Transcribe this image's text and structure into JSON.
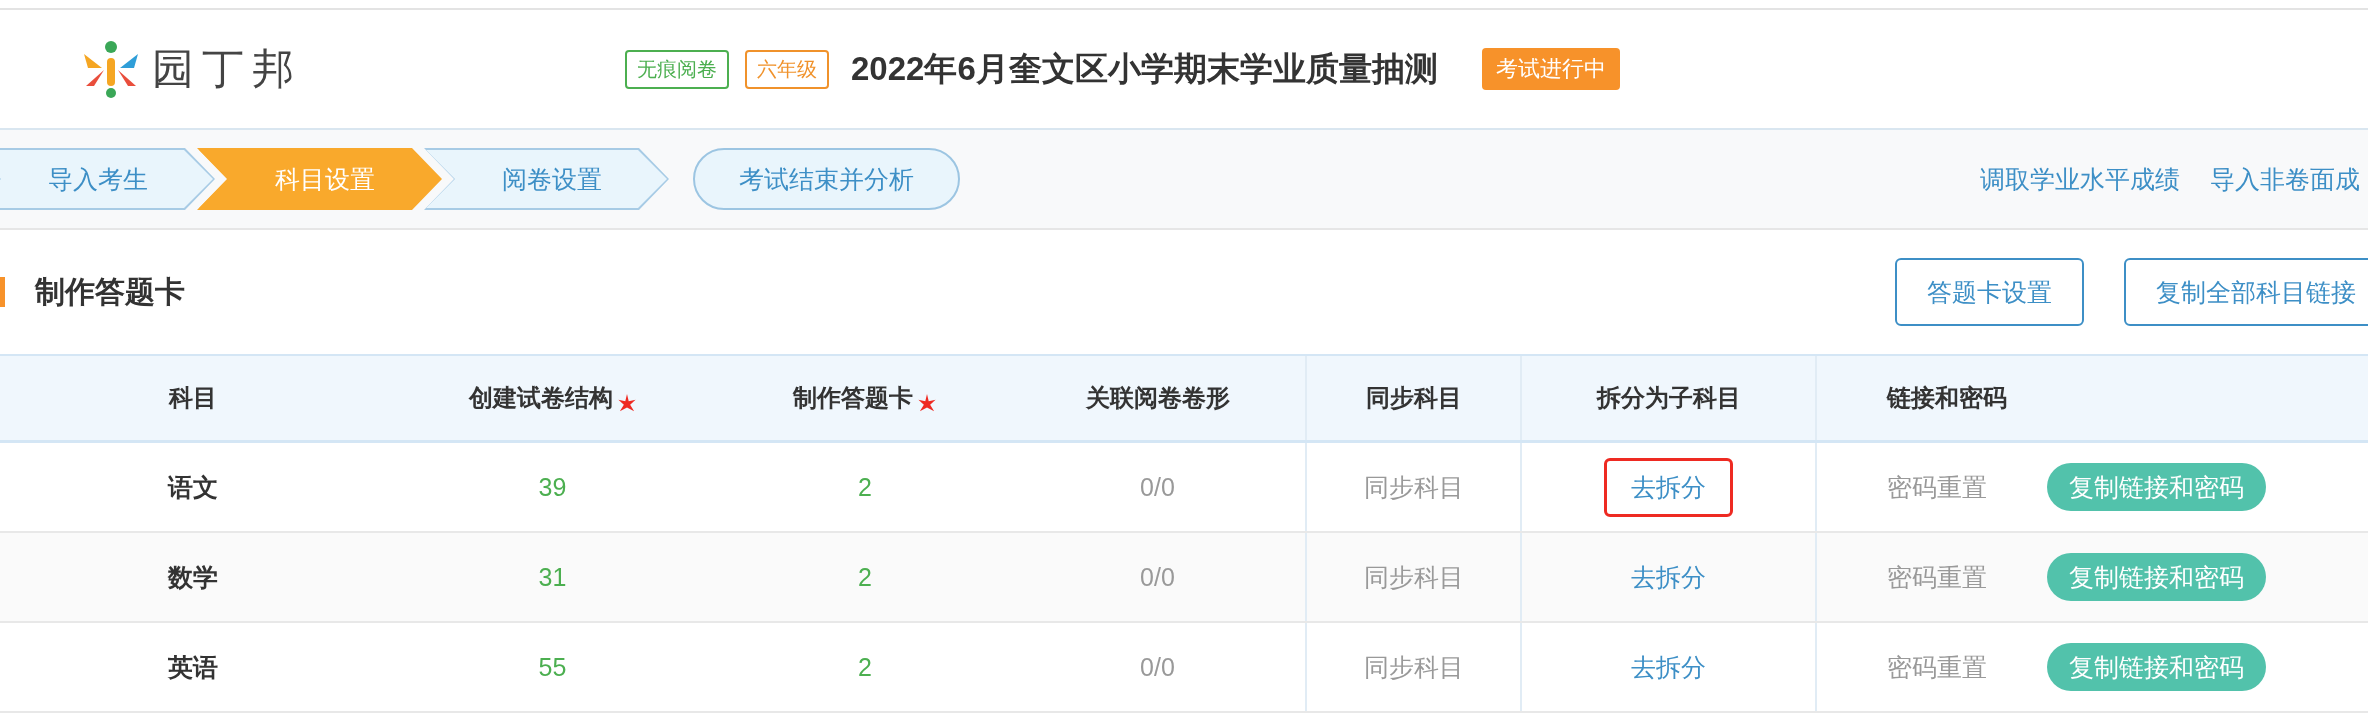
{
  "header": {
    "logo_text": "园丁邦",
    "tags": [
      {
        "label": "无痕阅卷",
        "color": "#4caf50"
      },
      {
        "label": "六年级",
        "color": "#f0922b"
      }
    ],
    "exam_title": "2022年6月奎文区小学期末学业质量抽测",
    "status_badge": "考试进行中"
  },
  "steps": [
    {
      "label": "导入考生",
      "selected": false
    },
    {
      "label": "科目设置",
      "selected": true
    },
    {
      "label": "阅卷设置",
      "selected": false
    }
  ],
  "finish_button": "考试结束并分析",
  "top_links": [
    "调取学业水平成绩",
    "导入非卷面成"
  ],
  "section": {
    "title": "制作答题卡",
    "buttons": [
      "答题卡设置",
      "复制全部科目链接"
    ]
  },
  "table": {
    "columns": [
      {
        "label": "科目",
        "required": false
      },
      {
        "label": "创建试卷结构",
        "required": true
      },
      {
        "label": "制作答题卡",
        "required": true
      },
      {
        "label": "关联阅卷卷形",
        "required": false
      },
      {
        "label": "同步科目",
        "required": false
      },
      {
        "label": "拆分为子科目",
        "required": false
      },
      {
        "label": "链接和密码",
        "required": false
      }
    ],
    "rows": [
      {
        "subject": "语文",
        "structure": "39",
        "cards": "2",
        "linked": "0/0",
        "sync": "同步科目",
        "split": "去拆分",
        "split_highlighted": true,
        "reset": "密码重置",
        "copy": "复制链接和密码"
      },
      {
        "subject": "数学",
        "structure": "31",
        "cards": "2",
        "linked": "0/0",
        "sync": "同步科目",
        "split": "去拆分",
        "split_highlighted": false,
        "reset": "密码重置",
        "copy": "复制链接和密码"
      },
      {
        "subject": "英语",
        "structure": "55",
        "cards": "2",
        "linked": "0/0",
        "sync": "同步科目",
        "split": "去拆分",
        "split_highlighted": false,
        "reset": "密码重置",
        "copy": "复制链接和密码"
      }
    ]
  }
}
